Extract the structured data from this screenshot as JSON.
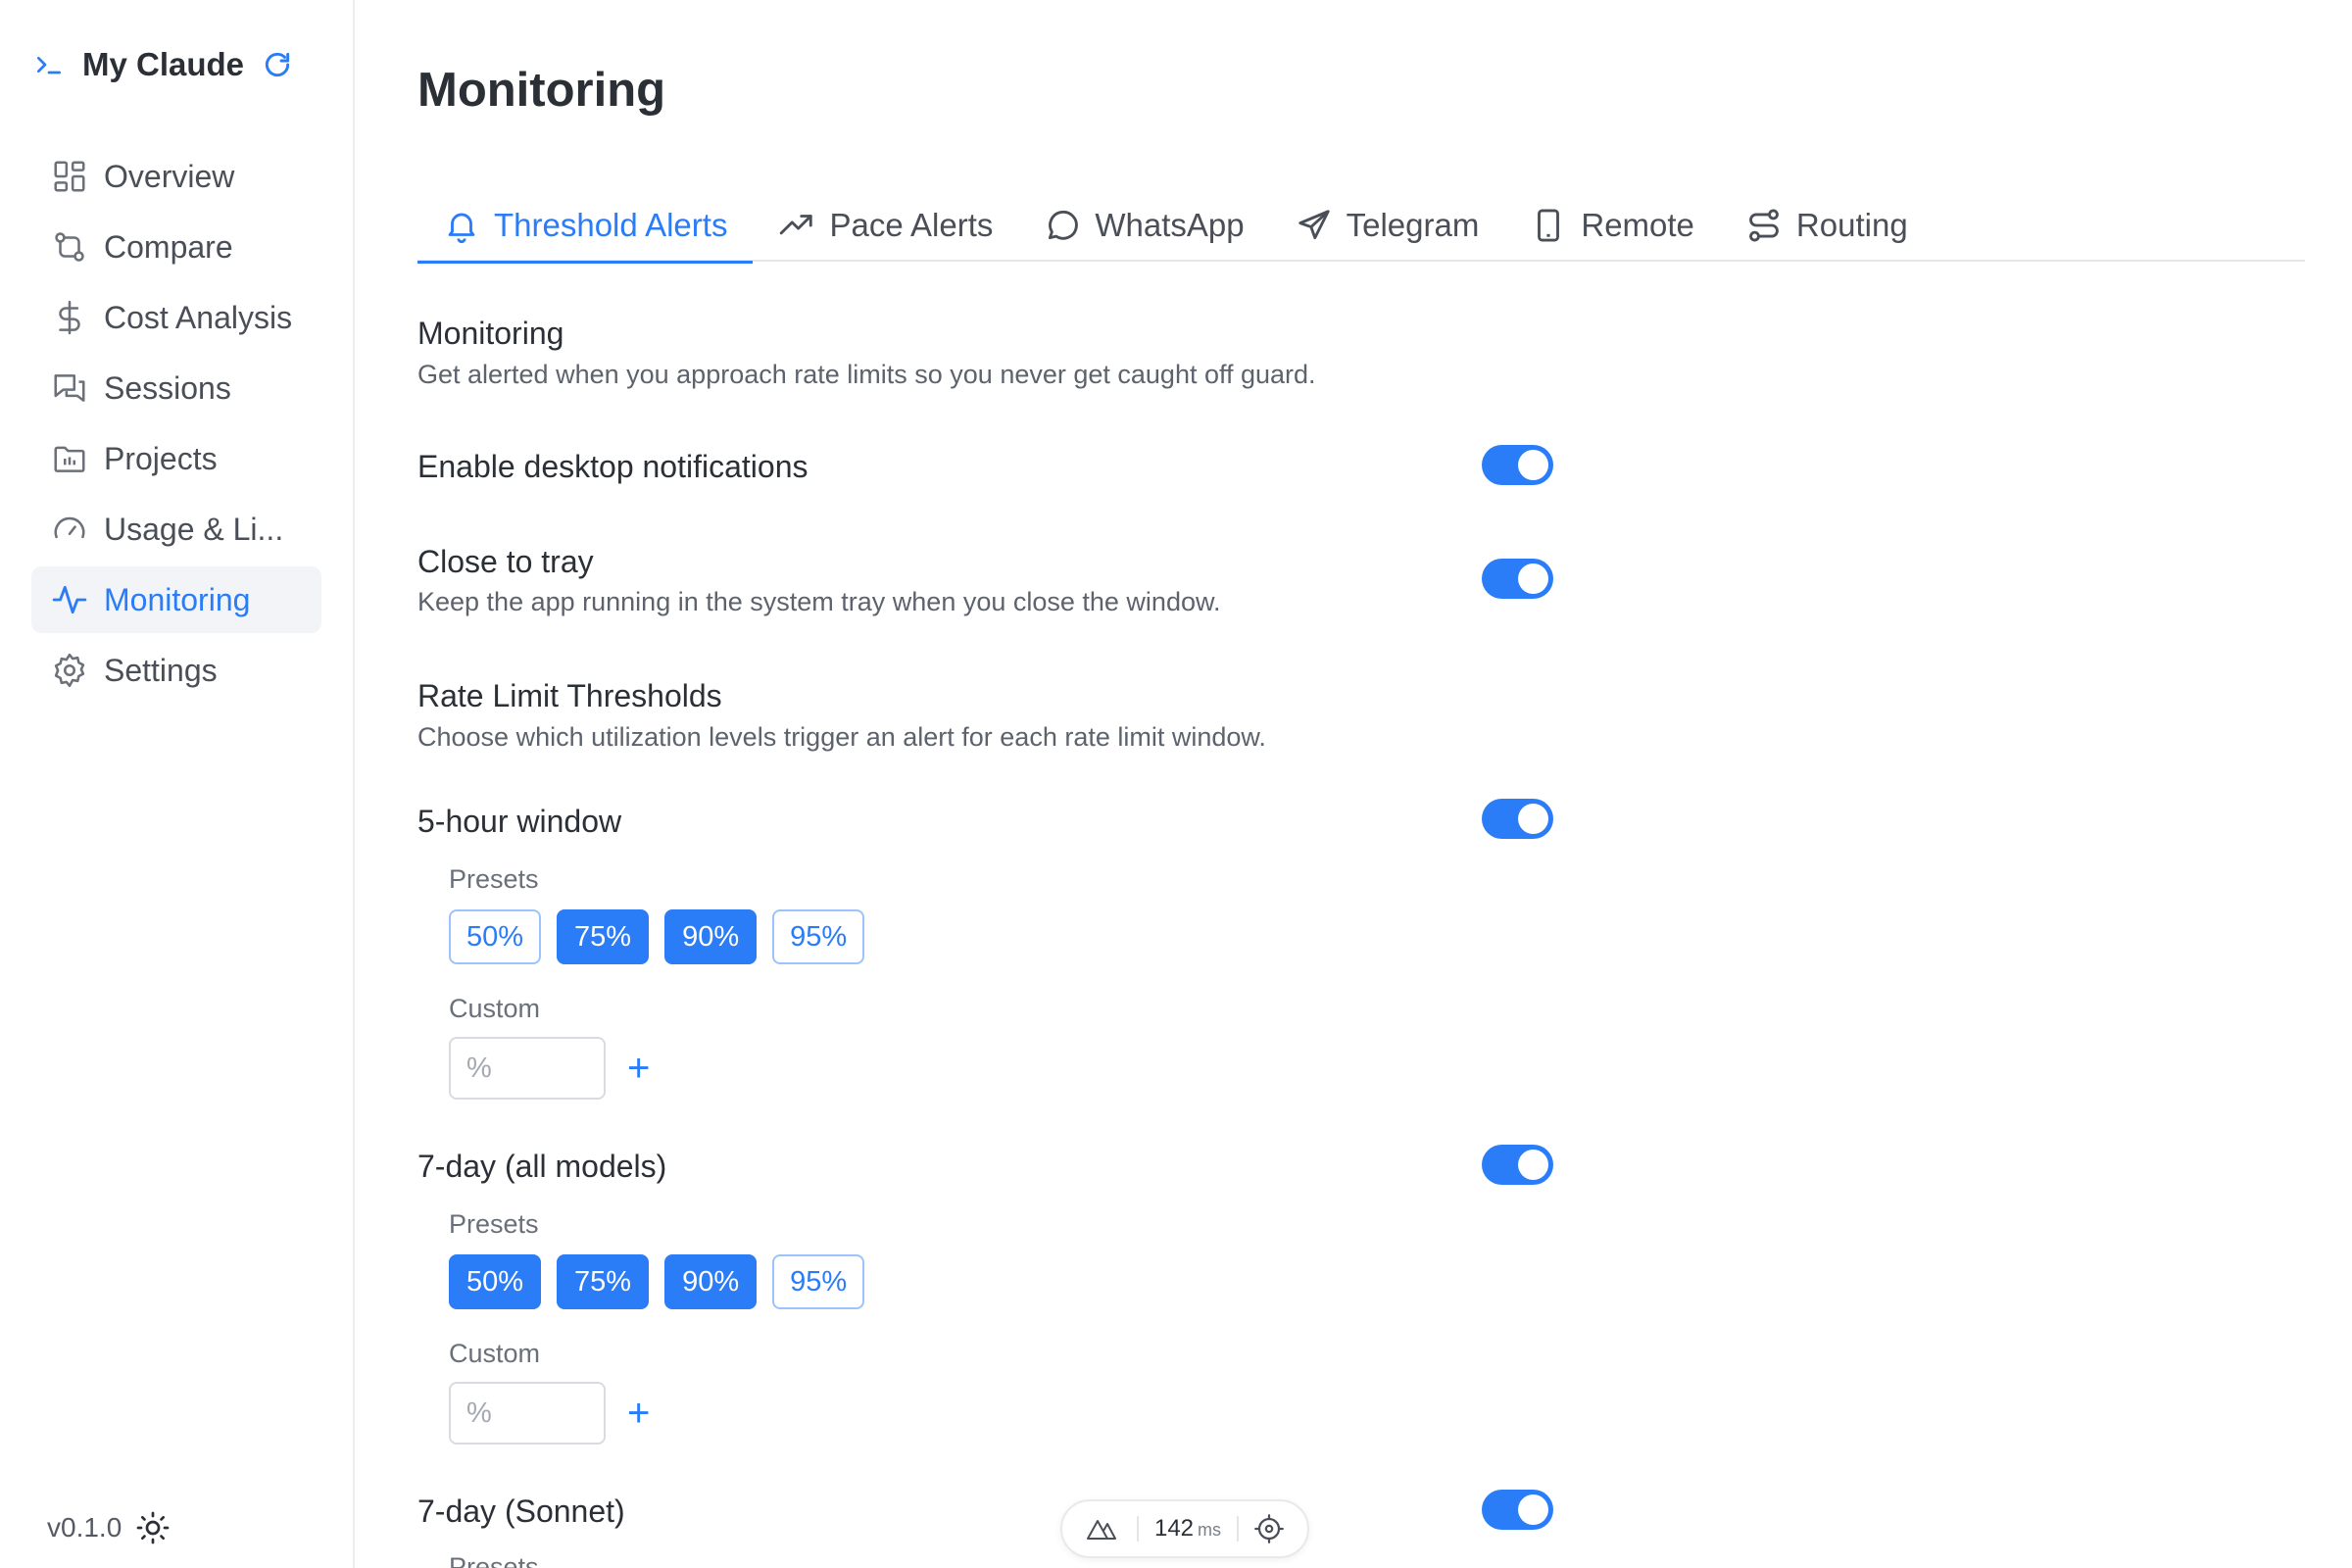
{
  "sidebar": {
    "brand": "My Claude",
    "items": [
      {
        "label": "Overview"
      },
      {
        "label": "Compare"
      },
      {
        "label": "Cost Analysis"
      },
      {
        "label": "Sessions"
      },
      {
        "label": "Projects"
      },
      {
        "label": "Usage & Li..."
      },
      {
        "label": "Monitoring"
      },
      {
        "label": "Settings"
      }
    ],
    "active": "Monitoring",
    "version": "v0.1.0"
  },
  "page": {
    "title": "Monitoring"
  },
  "tabs": [
    {
      "label": "Threshold Alerts"
    },
    {
      "label": "Pace Alerts"
    },
    {
      "label": "WhatsApp"
    },
    {
      "label": "Telegram"
    },
    {
      "label": "Remote"
    },
    {
      "label": "Routing"
    }
  ],
  "monitoring": {
    "title": "Monitoring",
    "description": "Get alerted when you approach rate limits so you never get caught off guard.",
    "desktop_notifications": {
      "label": "Enable desktop notifications",
      "enabled": true
    },
    "close_to_tray": {
      "label": "Close to tray",
      "description": "Keep the app running in the system tray when you close the window.",
      "enabled": true
    }
  },
  "thresholds": {
    "title": "Rate Limit Thresholds",
    "description": "Choose which utilization levels trigger an alert for each rate limit window.",
    "presets_label": "Presets",
    "custom_label": "Custom",
    "custom_placeholder": "%",
    "add_symbol": "+",
    "windows": [
      {
        "label": "5-hour window",
        "enabled": true,
        "presets": [
          {
            "label": "50%",
            "selected": false
          },
          {
            "label": "75%",
            "selected": true
          },
          {
            "label": "90%",
            "selected": true
          },
          {
            "label": "95%",
            "selected": false
          }
        ]
      },
      {
        "label": "7-day (all models)",
        "enabled": true,
        "presets": [
          {
            "label": "50%",
            "selected": true
          },
          {
            "label": "75%",
            "selected": true
          },
          {
            "label": "90%",
            "selected": true
          },
          {
            "label": "95%",
            "selected": false
          }
        ]
      },
      {
        "label": "7-day (Sonnet)",
        "enabled": true,
        "presets": []
      }
    ]
  },
  "dev_badge": {
    "latency": "142",
    "unit": "ms"
  },
  "colors": {
    "accent": "#2a7cf7",
    "text": "#2b2f36",
    "muted": "#5d636c"
  }
}
